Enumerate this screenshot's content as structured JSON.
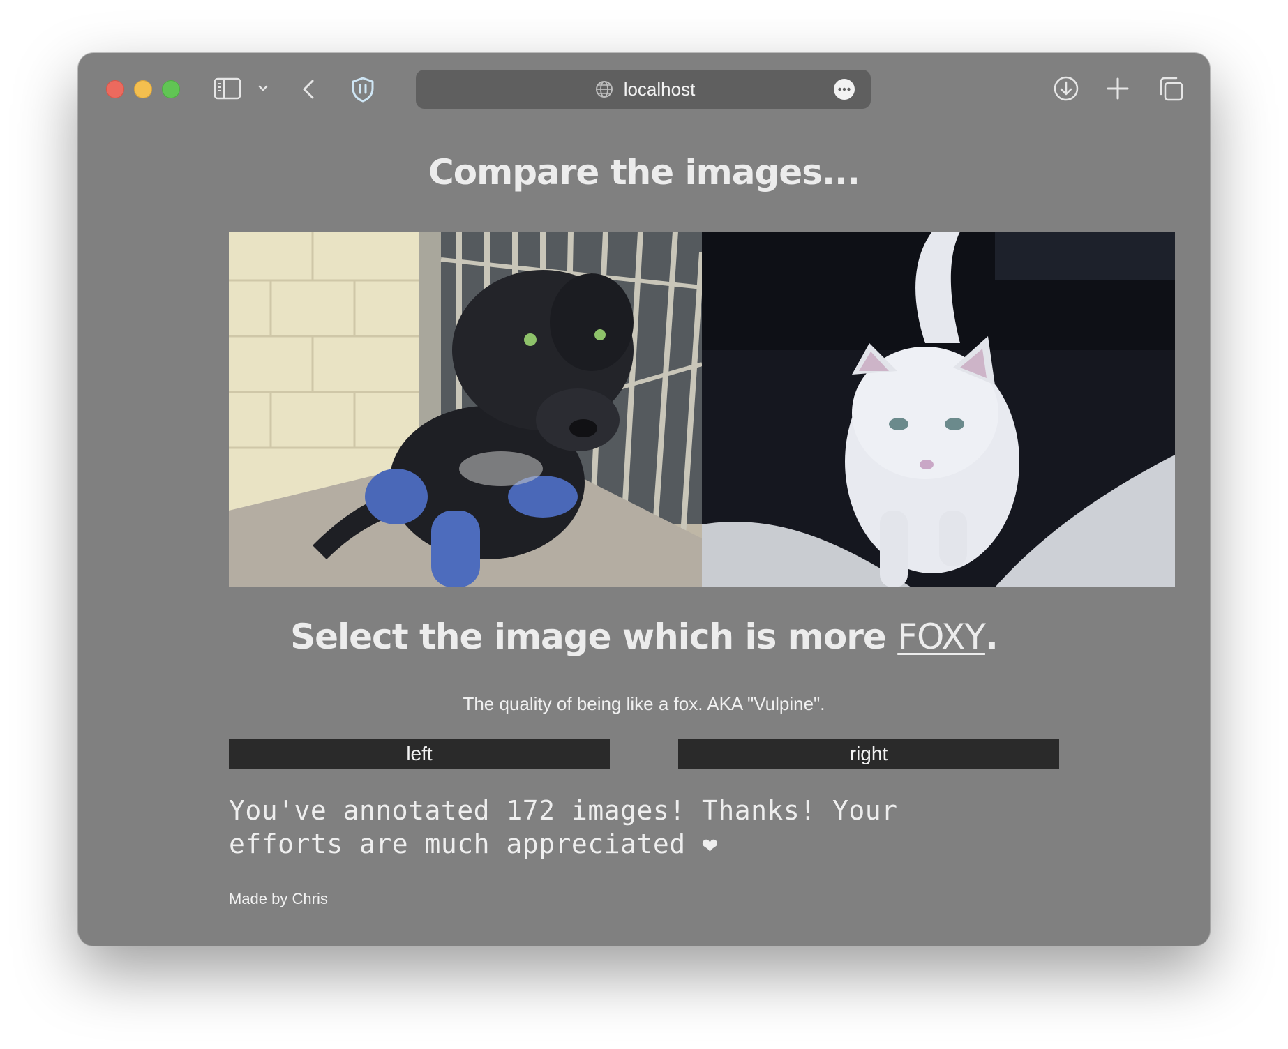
{
  "browser": {
    "address": "localhost"
  },
  "page": {
    "title": "Compare the images...",
    "question_prefix": "Select the image which is more ",
    "attribute": "FOXY",
    "question_suffix": ".",
    "description": "The quality of being like a fox. AKA \"Vulpine\".",
    "images": {
      "left": "puppy-photo",
      "right": "cat-photo"
    },
    "buttons": {
      "left": "left",
      "right": "right"
    },
    "thanks": "You've annotated 172 images! Thanks! Your efforts are much appreciated ❤",
    "footer": "Made by Chris"
  },
  "colors": {
    "window_bg": "#808080",
    "button_bg": "#2a2a2a",
    "address_bg": "#5f5f5f"
  }
}
